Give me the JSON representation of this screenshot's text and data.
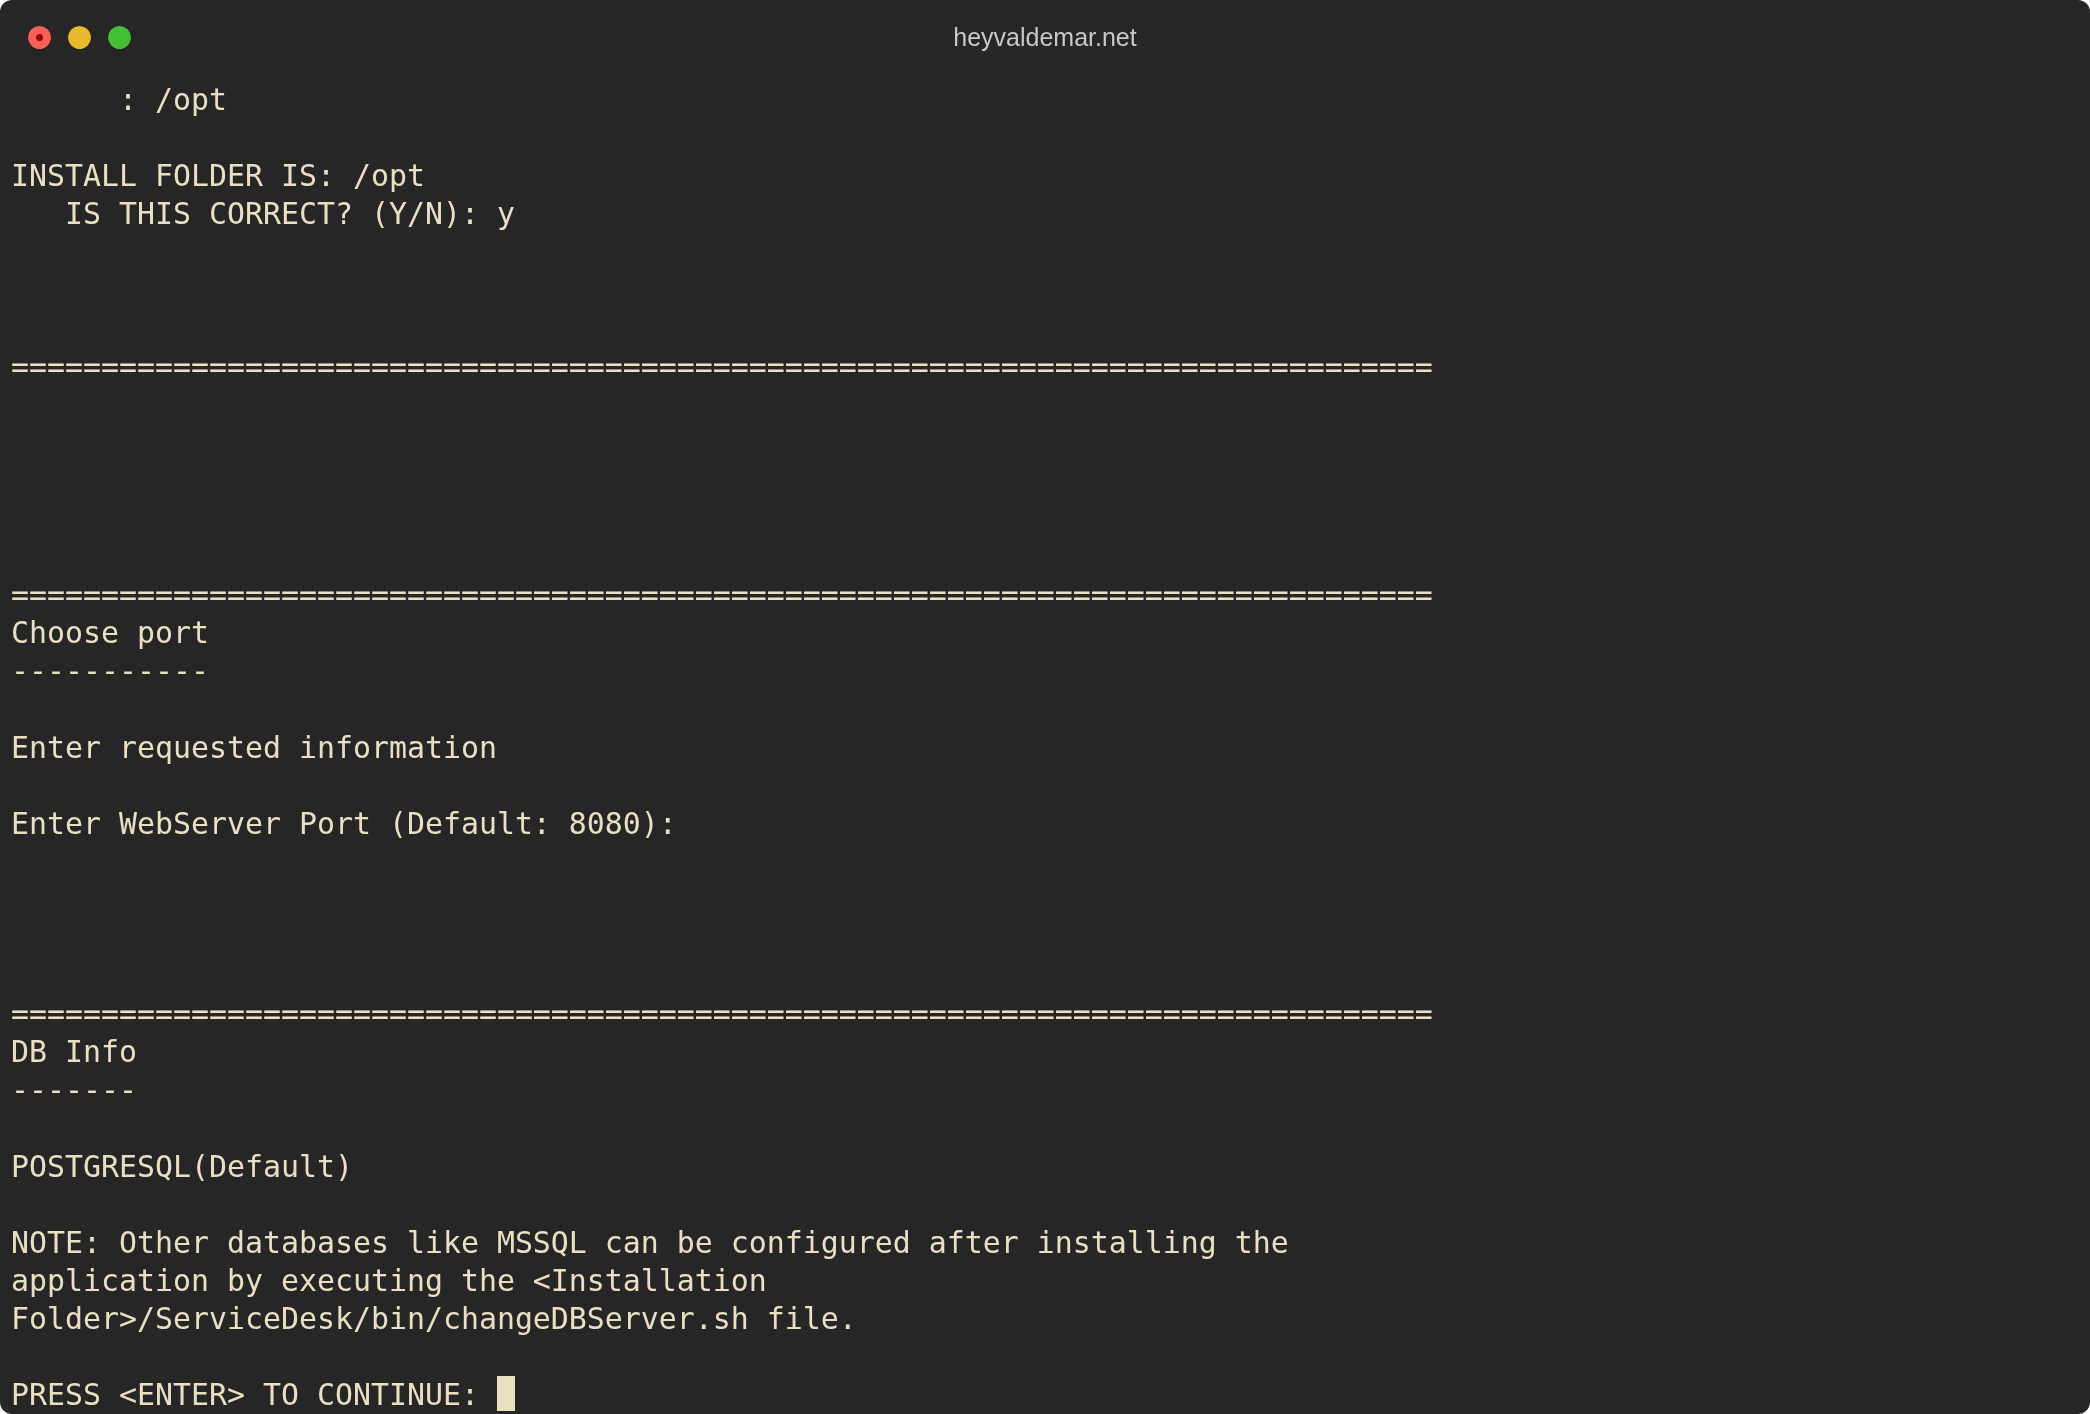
{
  "window": {
    "title": "heyvaldemar.net"
  },
  "terminal": {
    "lines": [
      {
        "kind": "text",
        "text": "      : /opt"
      },
      {
        "kind": "blank"
      },
      {
        "kind": "text",
        "text": "INSTALL FOLDER IS: /opt"
      },
      {
        "kind": "text",
        "text": "   IS THIS CORRECT? (Y/N): y"
      },
      {
        "kind": "blank"
      },
      {
        "kind": "blank"
      },
      {
        "kind": "blank"
      },
      {
        "kind": "text",
        "text": "==============================================================================="
      },
      {
        "kind": "blank"
      },
      {
        "kind": "blank"
      },
      {
        "kind": "blank"
      },
      {
        "kind": "blank"
      },
      {
        "kind": "blank"
      },
      {
        "kind": "text",
        "text": "==============================================================================="
      },
      {
        "kind": "text",
        "text": "Choose port"
      },
      {
        "kind": "text",
        "text": "-----------"
      },
      {
        "kind": "blank"
      },
      {
        "kind": "text",
        "text": "Enter requested information"
      },
      {
        "kind": "blank"
      },
      {
        "kind": "text",
        "text": "Enter WebServer Port (Default: 8080):"
      },
      {
        "kind": "blank"
      },
      {
        "kind": "blank"
      },
      {
        "kind": "blank"
      },
      {
        "kind": "blank"
      },
      {
        "kind": "text",
        "text": "==============================================================================="
      },
      {
        "kind": "text",
        "text": "DB Info"
      },
      {
        "kind": "text",
        "text": "-------"
      },
      {
        "kind": "blank"
      },
      {
        "kind": "text",
        "text": "POSTGRESQL(Default)"
      },
      {
        "kind": "blank"
      },
      {
        "kind": "text",
        "text": "NOTE: Other databases like MSSQL can be configured after installing the"
      },
      {
        "kind": "text",
        "text": "application by executing the <Installation"
      },
      {
        "kind": "text",
        "text": "Folder>/ServiceDesk/bin/changeDBServer.sh file."
      },
      {
        "kind": "blank"
      }
    ],
    "prompt": {
      "text": "PRESS <ENTER> TO CONTINUE: ",
      "cursor": true
    }
  }
}
